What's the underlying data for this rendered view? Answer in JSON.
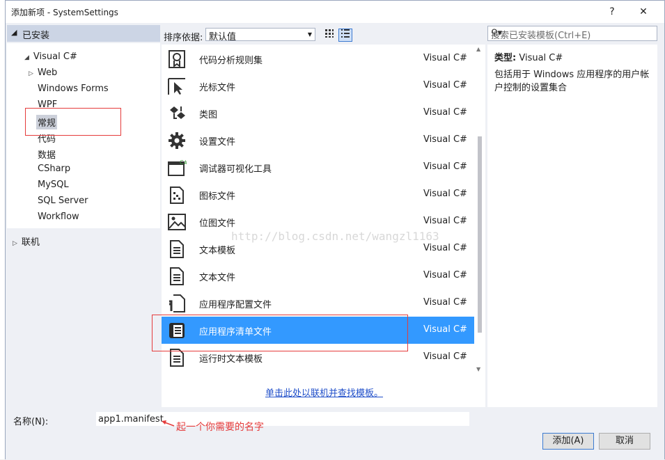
{
  "window": {
    "title": "添加新项 - SystemSettings",
    "help_label": "?",
    "close_label": "✕"
  },
  "sidebar": {
    "installed_label": "已安装",
    "root_label": "Visual C#",
    "web_label": "Web",
    "items": [
      "Windows Forms",
      "WPF",
      "常规",
      "代码",
      "数据",
      "CSharp",
      "MySQL",
      "SQL Server",
      "Workflow"
    ],
    "selected": "常规",
    "online_label": "联机"
  },
  "sort": {
    "label": "排序依据:",
    "value": "默认值"
  },
  "templates": [
    {
      "name": "代码分析规则集",
      "lang": "Visual C#",
      "icon": "ribbon-icon"
    },
    {
      "name": "光标文件",
      "lang": "Visual C#",
      "icon": "cursor-icon"
    },
    {
      "name": "类图",
      "lang": "Visual C#",
      "icon": "class-diagram-icon"
    },
    {
      "name": "设置文件",
      "lang": "Visual C#",
      "icon": "gear-icon"
    },
    {
      "name": "调试器可视化工具",
      "lang": "Visual C#",
      "icon": "window-icon"
    },
    {
      "name": "图标文件",
      "lang": "Visual C#",
      "icon": "icon-file-icon"
    },
    {
      "name": "位图文件",
      "lang": "Visual C#",
      "icon": "image-icon"
    },
    {
      "name": "文本模板",
      "lang": "Visual C#",
      "icon": "document-icon"
    },
    {
      "name": "文本文件",
      "lang": "Visual C#",
      "icon": "document-icon"
    },
    {
      "name": "应用程序配置文件",
      "lang": "Visual C#",
      "icon": "wrench-doc-icon"
    },
    {
      "name": "应用程序清单文件",
      "lang": "Visual C#",
      "icon": "manifest-icon"
    },
    {
      "name": "运行时文本模板",
      "lang": "Visual C#",
      "icon": "document-icon"
    }
  ],
  "selected_template": "应用程序清单文件",
  "online_link": "单击此处以联机并查找模板。",
  "watermark": "http://blog.csdn.net/wangzl1163",
  "search": {
    "placeholder": "搜索已安装模板(Ctrl+E)"
  },
  "detail": {
    "type_label": "类型:",
    "type_value": "Visual C#",
    "description": "包括用于 Windows 应用程序的用户帐户控制的设置集合"
  },
  "name_row": {
    "label": "名称(N):",
    "value": "app1.manifest",
    "note": "起一个你需要的名字"
  },
  "buttons": {
    "add": "添加(A)",
    "cancel": "取消"
  },
  "colors": {
    "selection": "#3399ff",
    "annotation": "#e53b3b",
    "link": "#1f4ec9"
  }
}
